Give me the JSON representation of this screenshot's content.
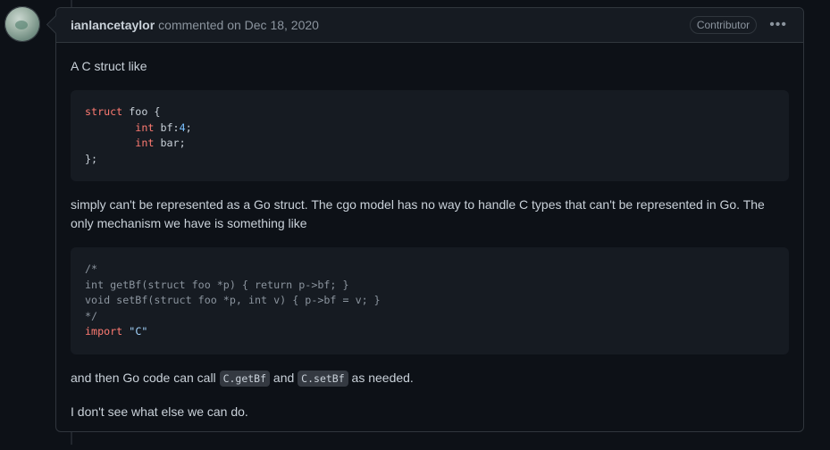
{
  "header": {
    "author": "ianlancetaylor",
    "action": "commented on",
    "date": "Dec 18, 2020",
    "role": "Contributor",
    "menu_icon": "kebab-horizontal-icon"
  },
  "body": {
    "p1": "A C struct like",
    "code1": {
      "l1_kw": "struct",
      "l1_rest": " foo {",
      "l2_indent": "        ",
      "l2_kw": "int",
      "l2_mid": " bf:",
      "l2_num": "4",
      "l2_end": ";",
      "l3_indent": "        ",
      "l3_kw": "int",
      "l3_rest": " bar;",
      "l4": "};"
    },
    "p2": "simply can't be represented as a Go struct. The cgo model has no way to handle C types that can't be represented in Go. The only mechanism we have is something like",
    "code2": {
      "l1": "/*",
      "l2": "int getBf(struct foo *p) { return p->bf; }",
      "l3": "void setBf(struct foo *p, int v) { p->bf = v; }",
      "l4": "*/",
      "l5_kw": "import",
      "l5_str": "\"C\""
    },
    "p3_a": "and then Go code can call ",
    "p3_code1": "C.getBf",
    "p3_b": " and ",
    "p3_code2": "C.setBf",
    "p3_c": " as needed.",
    "p4": "I don't see what else we can do."
  },
  "colors": {
    "background": "#0d1117",
    "border": "#30363d",
    "text": "#c9d1d9",
    "muted": "#8b949e",
    "keyword": "#ff7b72",
    "number": "#79c0ff"
  }
}
